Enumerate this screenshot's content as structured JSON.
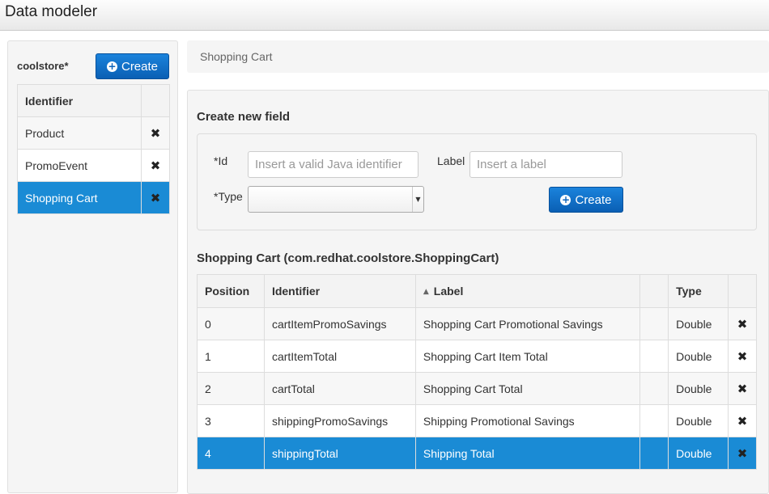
{
  "app": {
    "title": "Data modeler"
  },
  "sidebar": {
    "project_name": "coolstore*",
    "create_label": "Create",
    "table_header": "Identifier",
    "items": [
      {
        "label": "Product",
        "selected": false
      },
      {
        "label": "PromoEvent",
        "selected": false
      },
      {
        "label": "Shopping Cart",
        "selected": true
      }
    ]
  },
  "breadcrumb": {
    "text": "Shopping Cart"
  },
  "form": {
    "title": "Create new field",
    "id_label": "*Id",
    "id_placeholder": "Insert a valid Java identifier",
    "id_value": "",
    "label_label": "Label",
    "label_placeholder": "Insert a label",
    "label_value": "",
    "type_label": "*Type",
    "type_value": "",
    "create_label": "Create"
  },
  "fields_table": {
    "title": "Shopping Cart (com.redhat.coolstore.ShoppingCart)",
    "columns": {
      "position": "Position",
      "identifier": "Identifier",
      "label": "Label",
      "type": "Type"
    },
    "sort": {
      "column": "label",
      "direction": "ascending",
      "icon": "sort-up-icon"
    },
    "rows": [
      {
        "position": "0",
        "identifier": "cartItemPromoSavings",
        "label": "Shopping Cart Promotional Savings",
        "type": "Double",
        "selected": false
      },
      {
        "position": "1",
        "identifier": "cartItemTotal",
        "label": "Shopping Cart Item Total",
        "type": "Double",
        "selected": false
      },
      {
        "position": "2",
        "identifier": "cartTotal",
        "label": "Shopping Cart Total",
        "type": "Double",
        "selected": false
      },
      {
        "position": "3",
        "identifier": "shippingPromoSavings",
        "label": "Shipping Promotional Savings",
        "type": "Double",
        "selected": false
      },
      {
        "position": "4",
        "identifier": "shippingTotal",
        "label": "Shipping Total",
        "type": "Double",
        "selected": true
      }
    ]
  },
  "icons": {
    "delete": "close-icon",
    "create": "plus-circle-icon",
    "select": "caret-down-icon"
  },
  "colors": {
    "accent": "#1a8bd5",
    "button": "#0d64bb"
  }
}
